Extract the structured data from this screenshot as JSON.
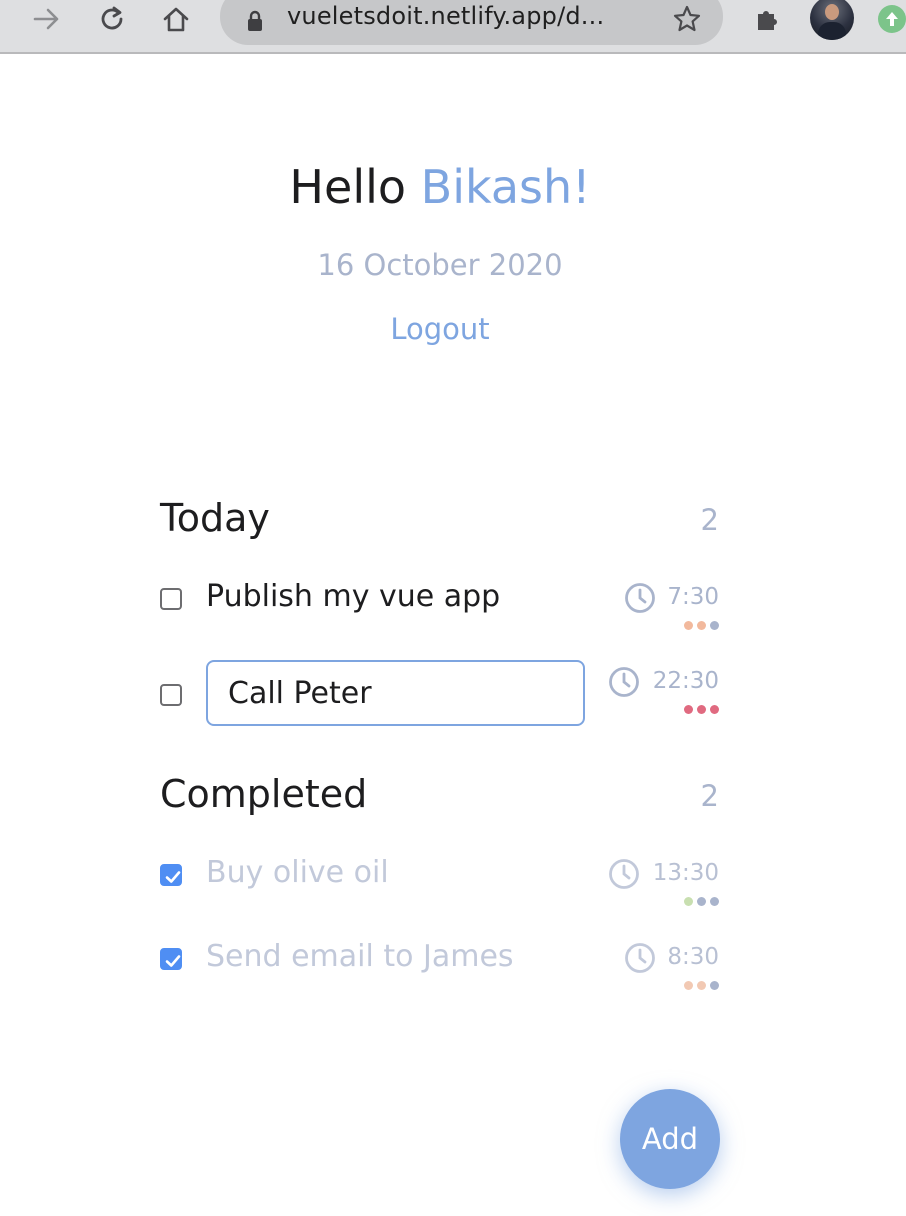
{
  "browser": {
    "url": "vueletsdoit.netlify.app/d..."
  },
  "header": {
    "greeting_prefix": "Hello",
    "user_name": "Bikash!",
    "date": "16 October 2020",
    "logout_label": "Logout"
  },
  "today": {
    "title": "Today",
    "count": "2",
    "tasks": [
      {
        "text": "Publish my vue app",
        "time": "7:30",
        "checked": false,
        "editing": false,
        "dot_colors": [
          "#f2b99d",
          "#f2b99d",
          "#a9b4cc"
        ]
      },
      {
        "text": "Call Peter",
        "time": "22:30",
        "checked": false,
        "editing": true,
        "dot_colors": [
          "#e06a80",
          "#e06a80",
          "#e06a80"
        ]
      }
    ]
  },
  "completed": {
    "title": "Completed",
    "count": "2",
    "tasks": [
      {
        "text": "Buy olive oil",
        "time": "13:30",
        "checked": true,
        "editing": false,
        "dot_colors": [
          "#c8dfb0",
          "#a9b4cc",
          "#a9b4cc"
        ]
      },
      {
        "text": "Send email to James",
        "time": "8:30",
        "checked": true,
        "editing": false,
        "dot_colors": [
          "#f2c9b3",
          "#f2c9b3",
          "#a9b4cc"
        ]
      }
    ]
  },
  "add_button": {
    "label": "Add"
  },
  "colors": {
    "accent": "#7ea5e0",
    "muted": "#a9b4cc",
    "checkbox_checked": "#4f8ef3"
  }
}
